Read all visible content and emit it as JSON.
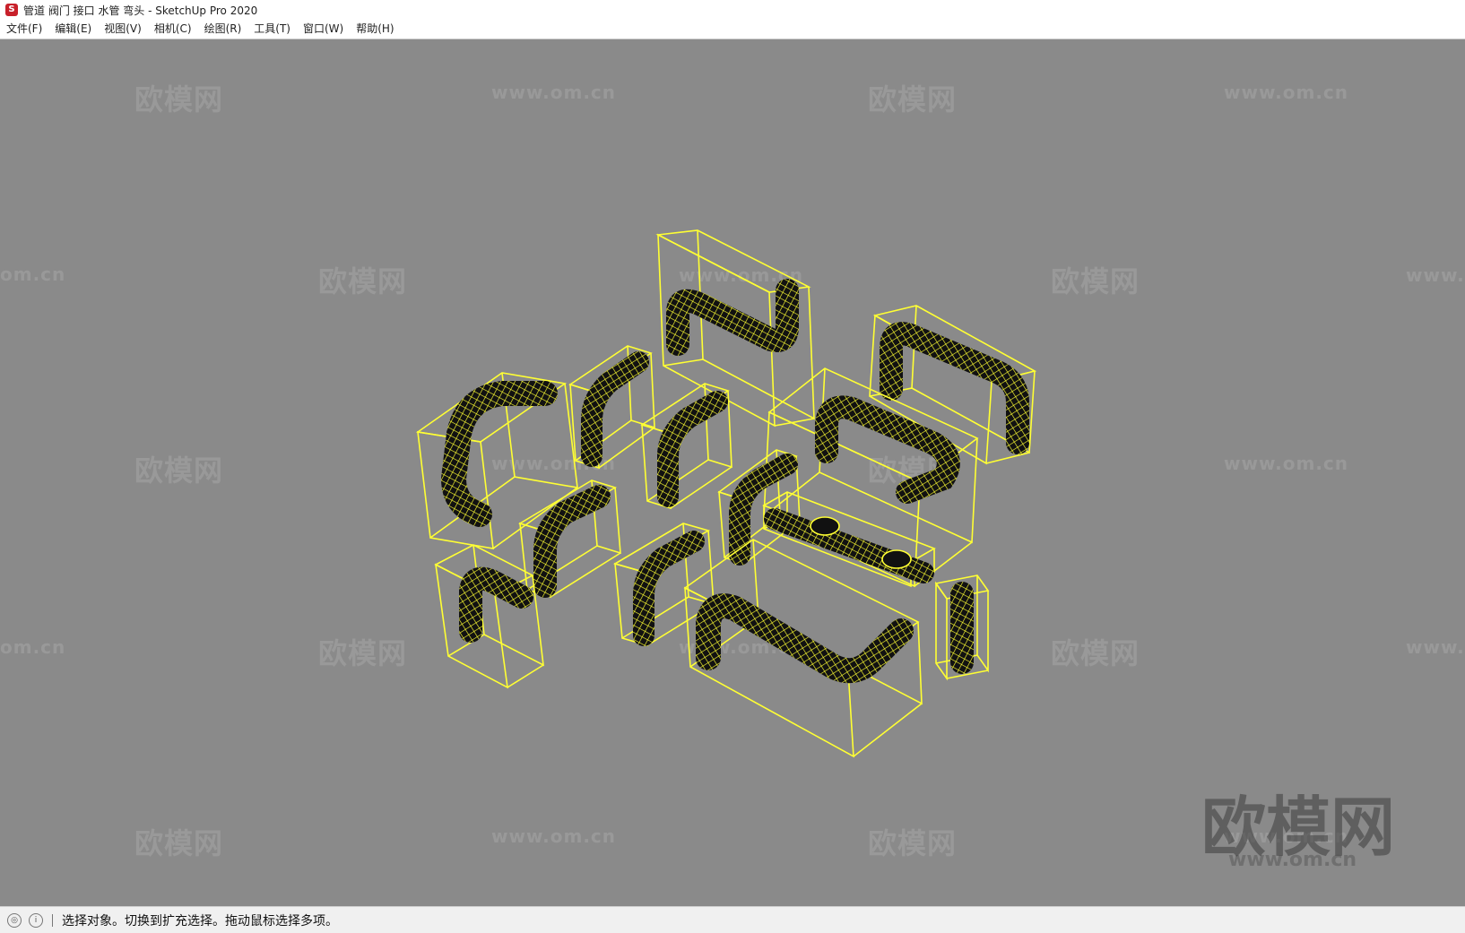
{
  "window": {
    "title": "管道 阀门 接口 水管 弯头 - SketchUp Pro 2020",
    "icon": "sketchup-logo-icon"
  },
  "menu": [
    {
      "label": "文件(F)"
    },
    {
      "label": "编辑(E)"
    },
    {
      "label": "视图(V)"
    },
    {
      "label": "相机(C)"
    },
    {
      "label": "绘图(R)"
    },
    {
      "label": "工具(T)"
    },
    {
      "label": "窗口(W)"
    },
    {
      "label": "帮助(H)"
    }
  ],
  "viewport": {
    "background": "#8a8a8a",
    "selection_color": "#ffff33",
    "watermark_brand": "欧模网",
    "watermark_url": "www.om.cn",
    "watermark_partial": "om.cn"
  },
  "status": {
    "geo_icon": "geo-location-icon",
    "info_icon": "info-icon",
    "message": "选择对象。切换到扩充选择。拖动鼠标选择多项。"
  }
}
